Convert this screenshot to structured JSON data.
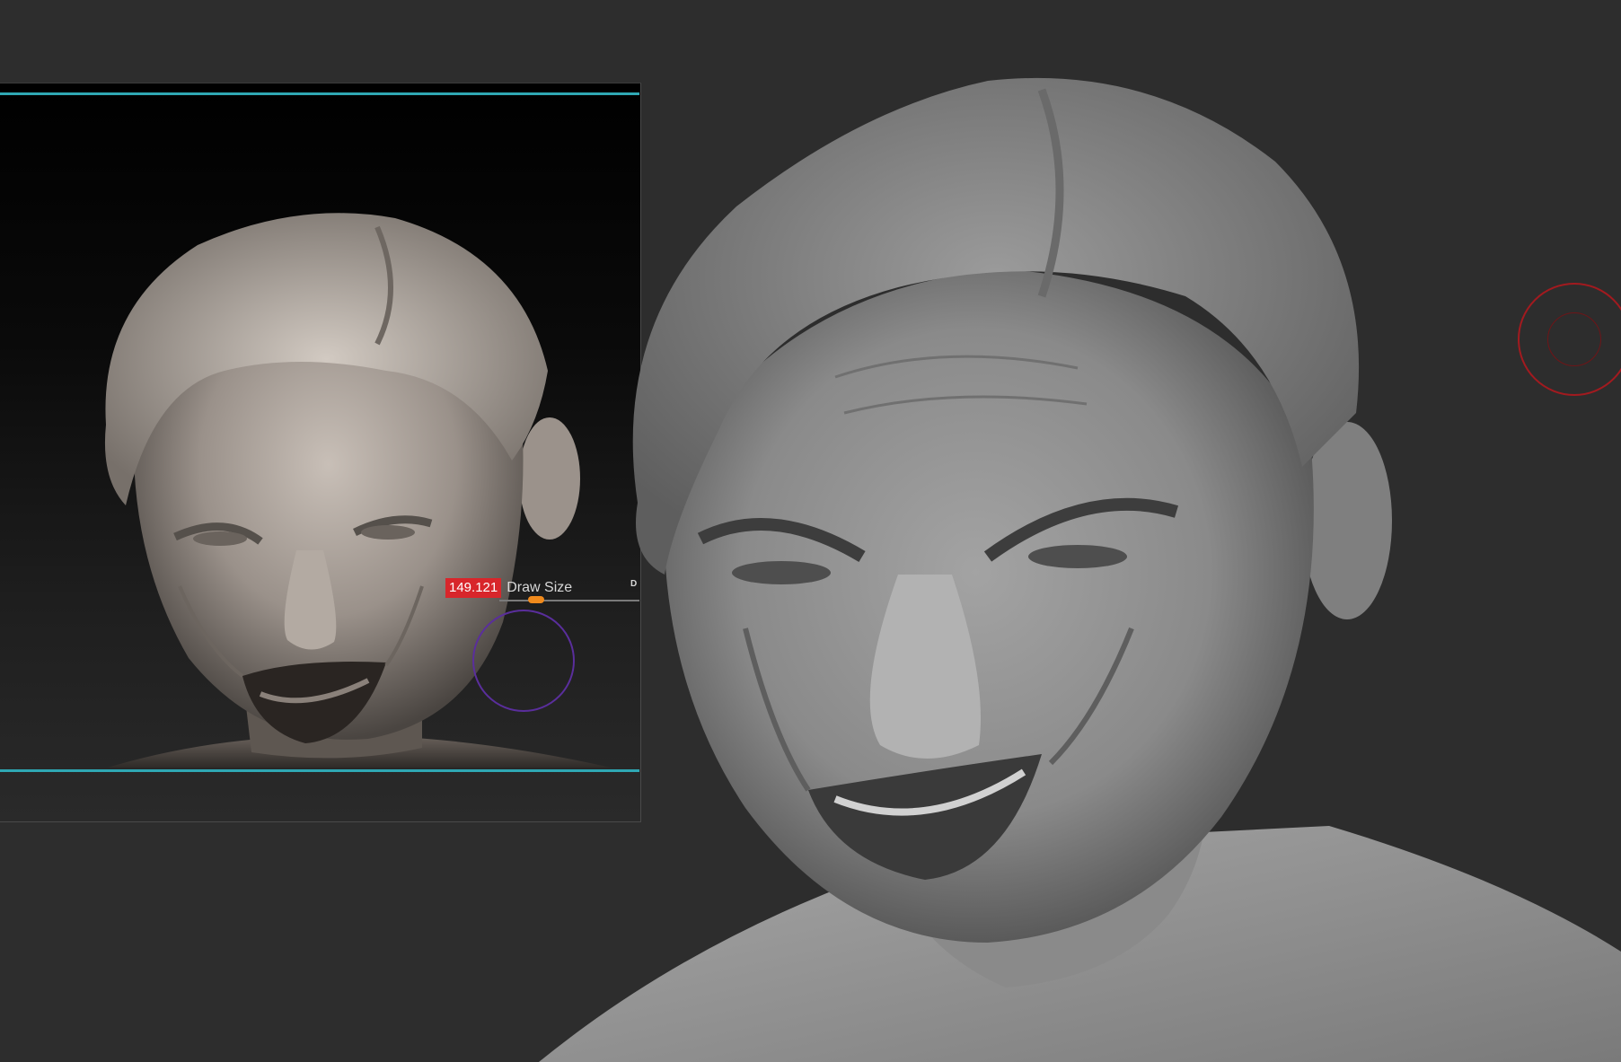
{
  "viewport": {
    "background_color": "#2d2d2d"
  },
  "reference_panel": {
    "accent_line_color": "#2fa8b4"
  },
  "draw_size": {
    "value": "149.121",
    "label": "Draw Size",
    "truncated_next_label": "D",
    "value_bg_color": "#d8262b",
    "knob_color": "#f08a1c"
  },
  "icons": {
    "brush_cursor": "brush-cursor-icon",
    "reference_brush_cursor": "brush-cursor-icon"
  }
}
